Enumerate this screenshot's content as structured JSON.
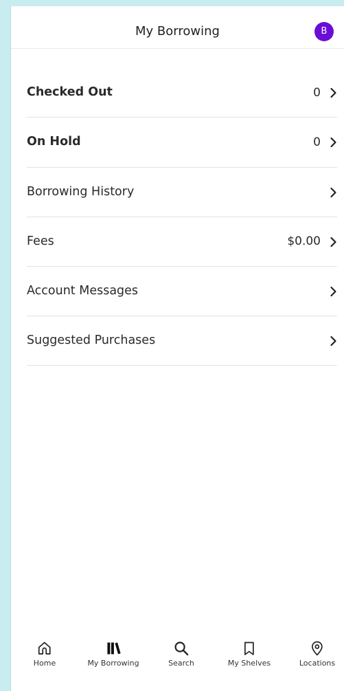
{
  "header": {
    "title": "My Borrowing",
    "avatar_initial": "B"
  },
  "items": [
    {
      "label": "Checked Out",
      "value": "0"
    },
    {
      "label": "On Hold",
      "value": "0"
    },
    {
      "label": "Borrowing History",
      "value": ""
    },
    {
      "label": "Fees",
      "value": "$0.00"
    },
    {
      "label": "Account Messages",
      "value": ""
    },
    {
      "label": "Suggested Purchases",
      "value": ""
    }
  ],
  "tabs": [
    {
      "label": "Home",
      "icon": "home-icon"
    },
    {
      "label": "My Borrowing",
      "icon": "books-icon"
    },
    {
      "label": "Search",
      "icon": "search-icon"
    },
    {
      "label": "My Shelves",
      "icon": "bookmark-icon"
    },
    {
      "label": "Locations",
      "icon": "location-pin-icon"
    }
  ],
  "colors": {
    "background": "#c9ecf1",
    "avatar": "#6a0dd8",
    "text": "#2a2a2a"
  }
}
